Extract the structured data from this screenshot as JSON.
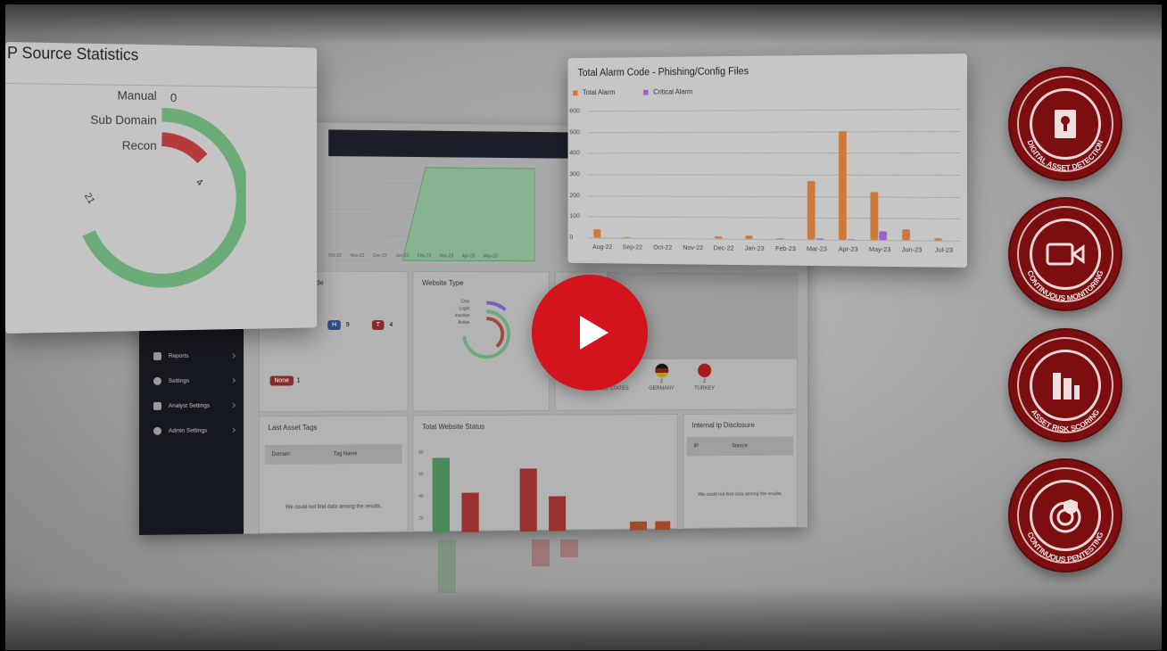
{
  "ip_panel": {
    "title": "P Source Statistics",
    "labels": {
      "manual": "Manual",
      "manual_value": "0",
      "subdomain": "Sub Domain",
      "recon": "Recon"
    },
    "ring_values": {
      "red": "4",
      "green": "21"
    }
  },
  "alarm_chart": {
    "title": "Total Alarm Code - Phishing/Config Files",
    "legend": [
      {
        "name": "Total Alarm",
        "color": "#d07a3a"
      },
      {
        "name": "Critical Alarm",
        "color": "#9a5fcf"
      }
    ],
    "y_ticks": [
      "600",
      "500",
      "400",
      "300",
      "200",
      "100",
      "0"
    ],
    "x_labels": [
      "Aug-22",
      "Sep-22",
      "Oct-22",
      "Nov-22",
      "Dec-22",
      "Jan-23",
      "Feb-23",
      "Mar-23",
      "Apr-23",
      "May-23",
      "Jun-23",
      "Jul-23"
    ]
  },
  "chart_data": {
    "type": "bar",
    "title": "Total Alarm Code - Phishing/Config Files",
    "categories": [
      "Aug-22",
      "Sep-22",
      "Oct-22",
      "Nov-22",
      "Dec-22",
      "Jan-23",
      "Feb-23",
      "Mar-23",
      "Apr-23",
      "May-23",
      "Jun-23",
      "Jul-23"
    ],
    "series": [
      {
        "name": "Total Alarm",
        "values": [
          40,
          3,
          0,
          0,
          10,
          15,
          4,
          270,
          500,
          220,
          50,
          10
        ]
      },
      {
        "name": "Critical Alarm",
        "values": [
          0,
          0,
          0,
          0,
          0,
          0,
          0,
          5,
          2,
          40,
          0,
          0
        ]
      }
    ],
    "ylim": [
      0,
      600
    ],
    "grid": true,
    "legend": "top-left"
  },
  "dashboard": {
    "sidebar": [
      {
        "label": "Reports",
        "icon": "report-icon"
      },
      {
        "label": "Settings",
        "icon": "gear-icon"
      },
      {
        "label": "Analyst Settings",
        "icon": "analyst-icon"
      },
      {
        "label": "Admin Settings",
        "icon": "admin-gear-icon"
      }
    ],
    "tags_card_title": "ade",
    "tag_badges": [
      {
        "label": "H",
        "count": "9"
      },
      {
        "label": "T",
        "count": "4"
      },
      {
        "label": "None",
        "count": "1"
      }
    ],
    "website_type_title": "Website Type",
    "website_type_labels": [
      "Cms",
      "Login",
      "Inactive",
      "Active"
    ],
    "flags": [
      {
        "name": "UNITED STATES",
        "count": "20"
      },
      {
        "name": "GERMANY",
        "count": "2"
      },
      {
        "name": "TURKEY",
        "count": "2"
      }
    ],
    "last_asset_tags": {
      "title": "Last Asset Tags",
      "col_domain": "Domain",
      "col_tag": "Tag Name",
      "empty": "We could not find data among the results."
    },
    "total_website_status": {
      "title": "Total Website Status",
      "y_ticks": [
        "80",
        "60",
        "40",
        "20"
      ]
    },
    "internal_ip": {
      "title": "Internal Ip Disclosure",
      "col_ip": "IP",
      "col_source": "Source",
      "empty": "We could not find data among the results."
    },
    "area_x_ticks": [
      "Oct-22",
      "Nov-22",
      "Dec-22",
      "Jan-23",
      "Feb-23",
      "Mar-23",
      "Apr-23",
      "May-23",
      "Jun-23",
      "Jul-23"
    ]
  },
  "badges": [
    {
      "text": "DIGITAL ASSET DETECTION",
      "icon": "lock-door-icon"
    },
    {
      "text": "CONTINUOUS MONITORING",
      "icon": "video-camera-icon"
    },
    {
      "text": "ASSET RISK SCORING",
      "icon": "bar-score-icon"
    },
    {
      "text": "CONTINUOUS PENTESTING",
      "icon": "shield-target-icon"
    }
  ],
  "play_button": {
    "icon": "play-icon"
  }
}
